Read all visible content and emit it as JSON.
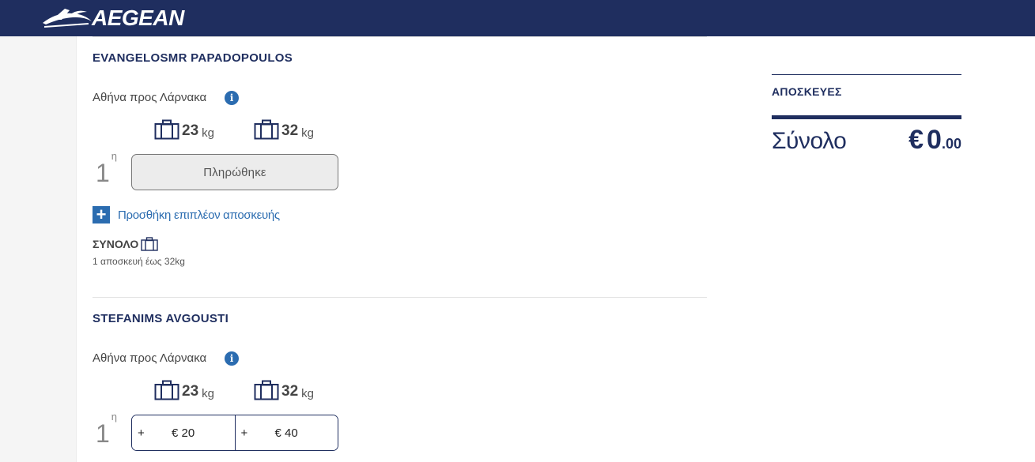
{
  "header": {
    "brand": "AEGEAN"
  },
  "passengers": [
    {
      "name": "EVANGELOSMR PAPADOPOULOS",
      "route": "Αθήνα προς Λάρνακα",
      "info": "i",
      "weights": [
        {
          "value": "23",
          "unit": "kg"
        },
        {
          "value": "32",
          "unit": "kg"
        }
      ],
      "ordinal": "1",
      "ordinal_sup": "η",
      "paid_label": "Πληρώθηκε",
      "add_plus": "+",
      "add_label": "Προσθήκη επιπλέον αποσκευής",
      "total_label": "ΣΥΝΟΛΟ",
      "total_desc": "1 αποσκευή έως 32kg"
    },
    {
      "name": "STEFANIMS AVGOUSTI",
      "route": "Αθήνα προς Λάρνακα",
      "info": "i",
      "weights": [
        {
          "value": "23",
          "unit": "kg"
        },
        {
          "value": "32",
          "unit": "kg"
        }
      ],
      "ordinal": "1",
      "ordinal_sup": "η",
      "options": [
        {
          "plus": "+",
          "price": "€ 20"
        },
        {
          "plus": "+",
          "price": "€ 40"
        }
      ]
    }
  ],
  "sidebar": {
    "title": "ΑΠΟΣΚΕΥΕΣ",
    "total_label": "Σύνολο",
    "currency": "€",
    "total_int": "0",
    "total_dec": ".00"
  },
  "colors": {
    "navy": "#1f2e5f",
    "accent": "#2b6cb0"
  },
  "icons": {
    "bag": "suitcase-icon",
    "info": "info-icon",
    "add": "plus-icon",
    "logo": "aegean-logo-mark"
  }
}
